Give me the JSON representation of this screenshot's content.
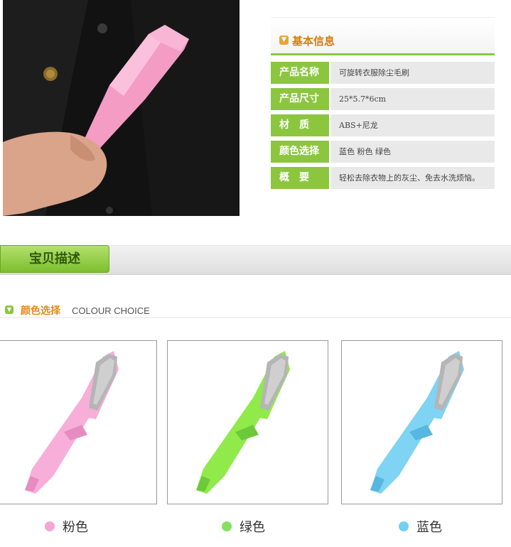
{
  "info": {
    "title": "基本信息",
    "rows": [
      {
        "label": "产品名称",
        "value": "可旋转衣服除尘毛刷"
      },
      {
        "label": "产品尺寸",
        "value": "25*5.7*6cm"
      },
      {
        "label": "材　质",
        "value": "ABS+尼龙"
      },
      {
        "label": "颜色选择",
        "value": "蓝色 粉色 绿色"
      },
      {
        "label": "概　要",
        "value": "轻松去除衣物上的灰尘、免去水洗烦恼。"
      }
    ]
  },
  "banner": {
    "label": "宝贝描述"
  },
  "colour_choice": {
    "title_cn": "颜色选择",
    "title_en": "COLOUR CHOICE"
  },
  "colors": [
    {
      "label": "粉色",
      "hex": "#f4a6d3",
      "brush": "#f7aed8",
      "shade": "#e68cc0"
    },
    {
      "label": "绿色",
      "hex": "#84e061",
      "brush": "#8fea4a",
      "shade": "#6cc93a"
    },
    {
      "label": "蓝色",
      "hex": "#72d0f0",
      "brush": "#7fd3f3",
      "shade": "#56b7e0"
    }
  ],
  "icons": {
    "section_icon": "chevron-down-icon"
  }
}
